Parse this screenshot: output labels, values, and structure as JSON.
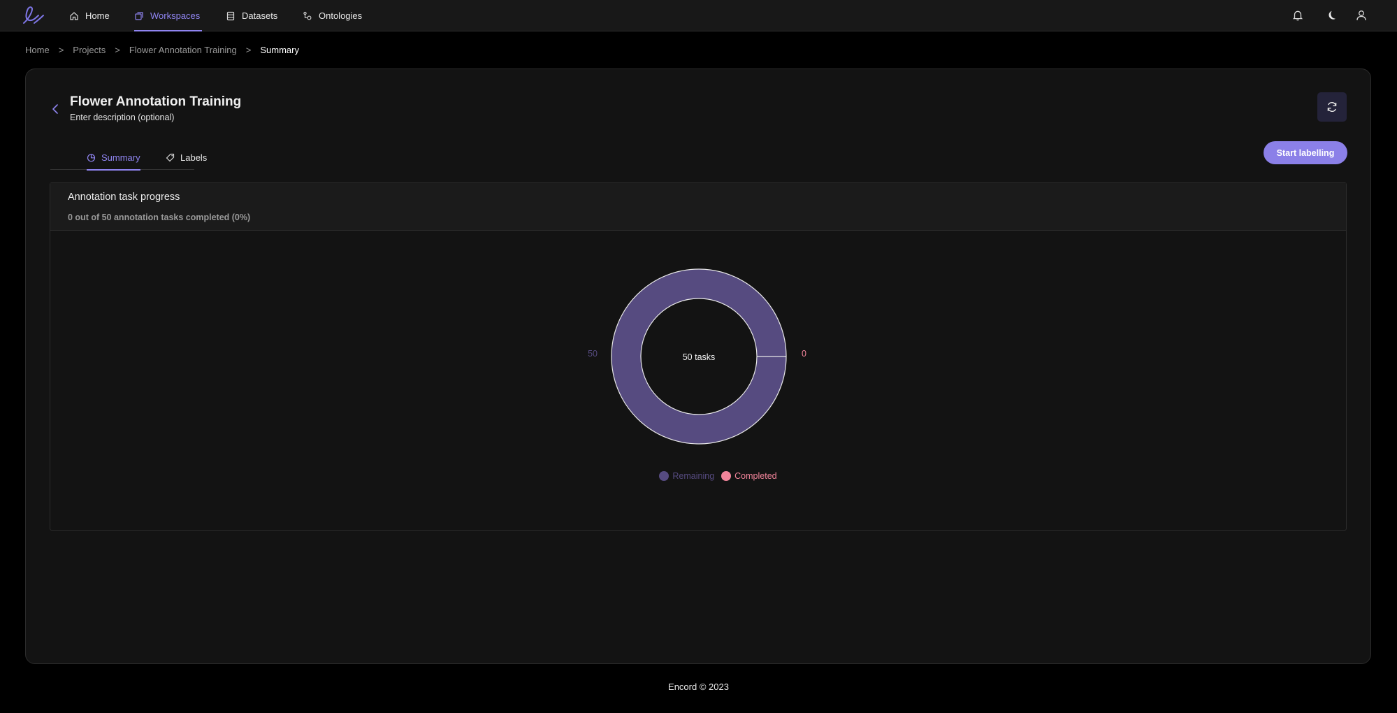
{
  "nav": {
    "items": [
      {
        "label": "Home",
        "icon": "home-icon"
      },
      {
        "label": "Workspaces",
        "icon": "workspaces-icon"
      },
      {
        "label": "Datasets",
        "icon": "datasets-icon"
      },
      {
        "label": "Ontologies",
        "icon": "ontologies-icon"
      }
    ],
    "active": "Workspaces",
    "right_icons": [
      "bell-icon",
      "moon-icon",
      "user-icon"
    ],
    "accent": "#8f84f0"
  },
  "breadcrumb": [
    "Home",
    "Projects",
    "Flower Annotation Training",
    "Summary"
  ],
  "breadcrumb_separator": ">",
  "project": {
    "title": "Flower Annotation Training",
    "description": "Enter description (optional)"
  },
  "tabs": [
    {
      "label": "Summary",
      "active": true
    },
    {
      "label": "Labels",
      "active": false
    }
  ],
  "start_button": "Start labelling",
  "progress": {
    "title": "Annotation task progress",
    "subtitle": "0 out of 50 annotation tasks completed (0%)"
  },
  "chart_data": {
    "type": "pie",
    "center_label": "50 tasks",
    "slices": [
      {
        "name": "Remaining",
        "value": 50,
        "color": "#564b80"
      },
      {
        "name": "Completed",
        "value": 0,
        "color": "#f2849a"
      }
    ],
    "value_labels": {
      "remaining": "50",
      "completed": "0"
    },
    "legend": [
      {
        "name": "Remaining",
        "color": "#564b80"
      },
      {
        "name": "Completed",
        "color": "#f2849a"
      }
    ],
    "legend_position": "bottom"
  },
  "footer": "Encord © 2023"
}
